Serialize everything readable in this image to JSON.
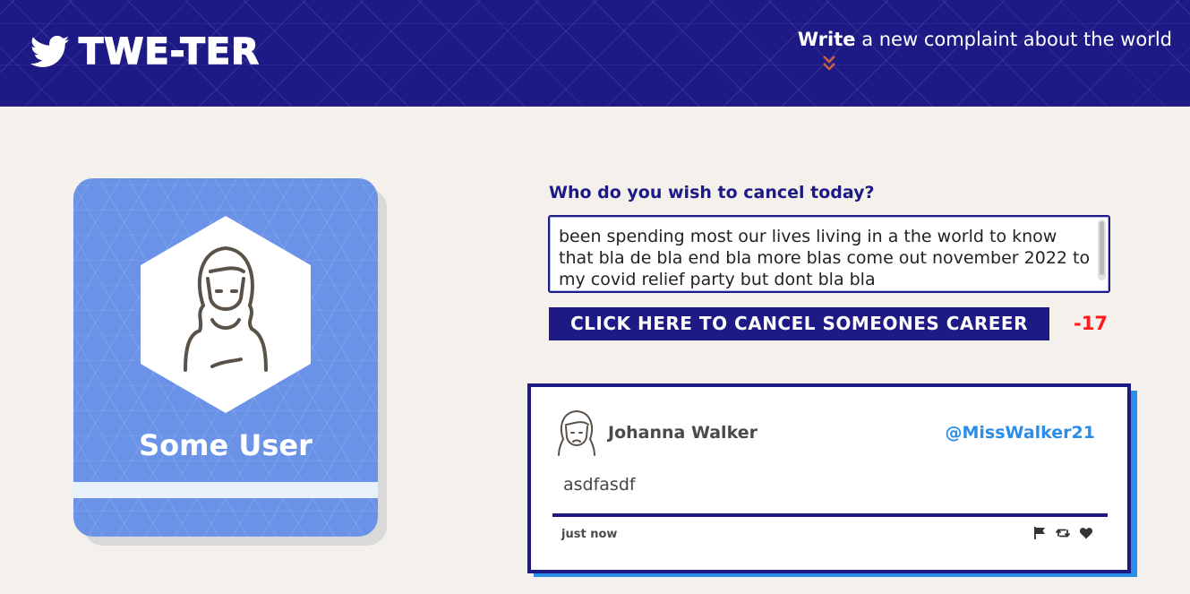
{
  "header": {
    "brand_name": "TWE-TER",
    "compose_toggle_bold": "Write",
    "compose_toggle_rest": " a new complaint about the world"
  },
  "profile": {
    "name": "Some User"
  },
  "compose": {
    "label": "Who do you wish to cancel today?",
    "text": "been spending most our lives living in a the world to know that bla de bla end bla more blas come out november 2022 to my covid relief party but dont bla bla",
    "submit_label": "CLICK HERE TO CANCEL SOMEONES CAREER",
    "char_counter": "-17"
  },
  "tweet": {
    "author": "Johanna Walker",
    "handle": "@MissWalker21",
    "body": "asdfasdf",
    "time": "just now",
    "actions": [
      "flag-icon",
      "retweet-icon",
      "heart-icon"
    ]
  },
  "colors": {
    "navy": "#1d1a85",
    "profile_blue": "#6a93e8",
    "accent_blue": "#2a8de8",
    "counter_red": "#ff1a1a",
    "background": "#f4f1ec"
  }
}
